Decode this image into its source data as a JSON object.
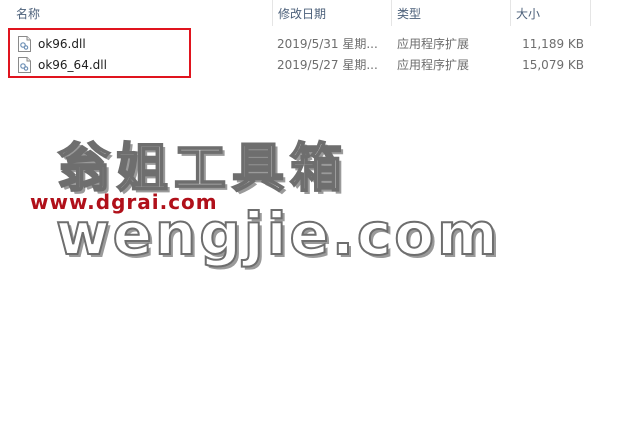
{
  "columns": {
    "name": "名称",
    "date": "修改日期",
    "type": "类型",
    "size": "大小"
  },
  "sort": {
    "column": "name",
    "direction": "ascending",
    "icon": "sort-up-arrow-icon"
  },
  "files": [
    {
      "name": "ok96.dll",
      "date": "2019/5/31 星期...",
      "type": "应用程序扩展",
      "size": "11,189 KB",
      "icon": "dll-file-icon"
    },
    {
      "name": "ok96_64.dll",
      "date": "2019/5/27 星期...",
      "type": "应用程序扩展",
      "size": "15,079 KB",
      "icon": "dll-file-icon"
    }
  ],
  "highlight_color": "#e0141e",
  "watermark": {
    "title": "翁姐工具箱",
    "site": "www.dgrai.com",
    "domain": "wengjie.com"
  }
}
